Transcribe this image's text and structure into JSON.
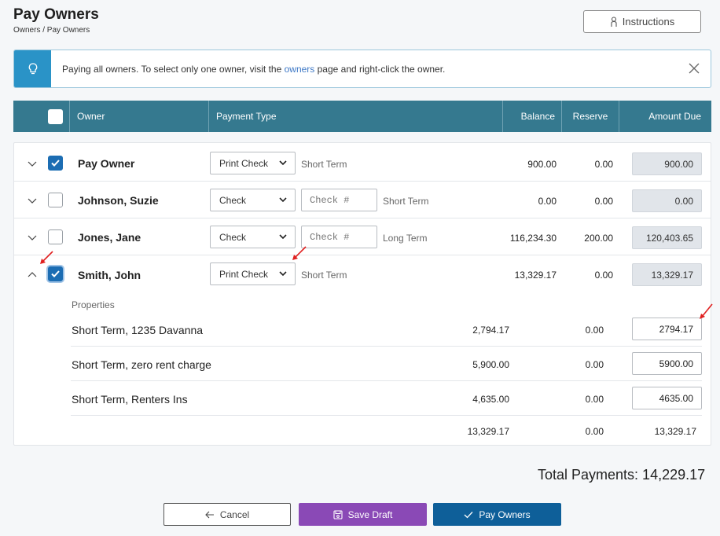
{
  "page": {
    "title": "Pay Owners",
    "breadcrumb": "Owners / Pay Owners"
  },
  "instructions_label": "Instructions",
  "banner": {
    "text_before": "Paying all owners. To select only one owner, visit the ",
    "link": "owners",
    "text_after": " page and right-click the owner."
  },
  "columns": {
    "owner": "Owner",
    "payment_type": "Payment Type",
    "balance": "Balance",
    "reserve": "Reserve",
    "amount_due": "Amount Due"
  },
  "owners": [
    {
      "name": "Pay Owner",
      "checked": true,
      "expanded": false,
      "payment_type": "Print Check",
      "check_placeholder": "",
      "term": "Short Term",
      "balance": "900.00",
      "reserve": "0.00",
      "amount_due": "900.00"
    },
    {
      "name": "Johnson, Suzie",
      "checked": false,
      "expanded": false,
      "payment_type": "Check",
      "check_placeholder": "Check #",
      "term": "Short Term",
      "balance": "0.00",
      "reserve": "0.00",
      "amount_due": "0.00"
    },
    {
      "name": "Jones, Jane",
      "checked": false,
      "expanded": false,
      "payment_type": "Check",
      "check_placeholder": "Check #",
      "term": "Long Term",
      "balance": "116,234.30",
      "reserve": "200.00",
      "amount_due": "120,403.65"
    },
    {
      "name": "Smith, John",
      "checked": true,
      "expanded": true,
      "payment_type": "Print Check",
      "check_placeholder": "",
      "term": "Short Term",
      "balance": "13,329.17",
      "reserve": "0.00",
      "amount_due": "13,329.17"
    }
  ],
  "properties": {
    "label": "Properties",
    "rows": [
      {
        "name": "Short Term, 1235 Davanna",
        "balance": "2,794.17",
        "reserve": "0.00",
        "amount": "2794.17"
      },
      {
        "name": "Short Term, zero rent charge",
        "balance": "5,900.00",
        "reserve": "0.00",
        "amount": "5900.00"
      },
      {
        "name": "Short Term, Renters Ins",
        "balance": "4,635.00",
        "reserve": "0.00",
        "amount": "4635.00"
      }
    ],
    "totals": {
      "balance": "13,329.17",
      "reserve": "0.00",
      "amount": "13,329.17"
    }
  },
  "total_payments": "Total Payments: 14,229.17",
  "buttons": {
    "cancel": "Cancel",
    "save_draft": "Save Draft",
    "pay_owners": "Pay Owners"
  },
  "colors": {
    "header": "#35798f",
    "info": "#2a93c7",
    "checkbox": "#1c6db3",
    "save_draft": "#8a49b6",
    "pay_owners": "#0e5f99",
    "annotation": "#e02020"
  },
  "icons": {
    "instructions": "person-icon",
    "info": "lightbulb-icon",
    "close": "close-icon",
    "chevron_down": "chevron-down-icon",
    "chevron_up": "chevron-up-icon",
    "caret": "caret-down-icon",
    "cancel": "arrow-left-icon",
    "save_draft": "save-icon",
    "pay": "checkmark-icon"
  }
}
